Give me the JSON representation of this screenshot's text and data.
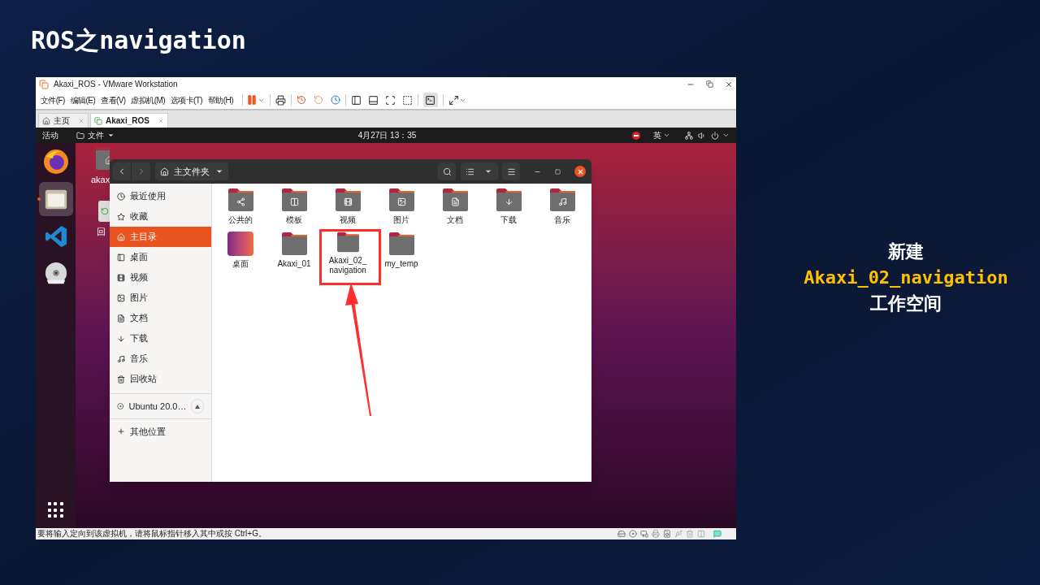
{
  "slide": {
    "title": "ROS之navigation",
    "caption": [
      {
        "text": "新建",
        "kind": "plain"
      },
      {
        "text": "Akaxi_02_navigation",
        "kind": "highlight"
      },
      {
        "text": "工作空间",
        "kind": "plain"
      }
    ]
  },
  "vmware": {
    "title": "Akaxi_ROS - VMware Workstation",
    "menu": [
      "文件(F)",
      "编辑(E)",
      "查看(V)",
      "虚拟机(M)",
      "选项卡(T)",
      "帮助(H)"
    ],
    "tabs": [
      {
        "label": "主页",
        "kind": "home",
        "selected": false
      },
      {
        "label": "Akaxi_ROS",
        "kind": "vm",
        "selected": true
      }
    ],
    "status_text": "要将输入定向到该虚拟机，请将鼠标指针移入其中或按 Ctrl+G。"
  },
  "ubuntu": {
    "activities": "活动",
    "app_menu": "文件",
    "clock": "4月27日 13：35",
    "input_method": "英"
  },
  "dock": [
    {
      "kind": "firefox",
      "running": false,
      "selected": false
    },
    {
      "kind": "files",
      "running": true,
      "selected": true
    },
    {
      "kind": "vscode",
      "running": false,
      "selected": false
    },
    {
      "kind": "dvd",
      "running": false,
      "selected": false
    }
  ],
  "desktop_icons": [
    {
      "label": "akax",
      "kind": "home"
    },
    {
      "label": "回",
      "kind": "trash"
    }
  ],
  "files": {
    "location": "主文件夹",
    "sidebar": [
      {
        "label": "最近使用",
        "kind": "recent",
        "selected": false
      },
      {
        "label": "收藏",
        "kind": "star",
        "selected": false
      },
      {
        "label": "主目录",
        "kind": "home",
        "selected": true
      },
      {
        "label": "桌面",
        "kind": "desktop",
        "selected": false
      },
      {
        "label": "视频",
        "kind": "video",
        "selected": false
      },
      {
        "label": "图片",
        "kind": "picture",
        "selected": false
      },
      {
        "label": "文档",
        "kind": "document",
        "selected": false
      },
      {
        "label": "下载",
        "kind": "download",
        "selected": false
      },
      {
        "label": "音乐",
        "kind": "music",
        "selected": false
      },
      {
        "label": "回收站",
        "kind": "trash",
        "selected": false
      }
    ],
    "device": "Ubuntu 20.0…",
    "other_locations": "其他位置",
    "items": [
      {
        "label": "公共的",
        "kind": "share",
        "marked": false
      },
      {
        "label": "模板",
        "kind": "template",
        "marked": false
      },
      {
        "label": "视频",
        "kind": "video",
        "marked": false
      },
      {
        "label": "图片",
        "kind": "picture",
        "marked": false
      },
      {
        "label": "文档",
        "kind": "document",
        "marked": false
      },
      {
        "label": "下载",
        "kind": "download",
        "marked": false
      },
      {
        "label": "音乐",
        "kind": "music",
        "marked": false
      },
      {
        "label": "桌面",
        "kind": "desktop",
        "marked": false
      },
      {
        "label": "Akaxi_01",
        "kind": "folder",
        "marked": false
      },
      {
        "label": "Akaxi_02_navigation",
        "kind": "folder",
        "marked": true
      },
      {
        "label": "my_temp",
        "kind": "folder",
        "marked": false
      }
    ]
  }
}
